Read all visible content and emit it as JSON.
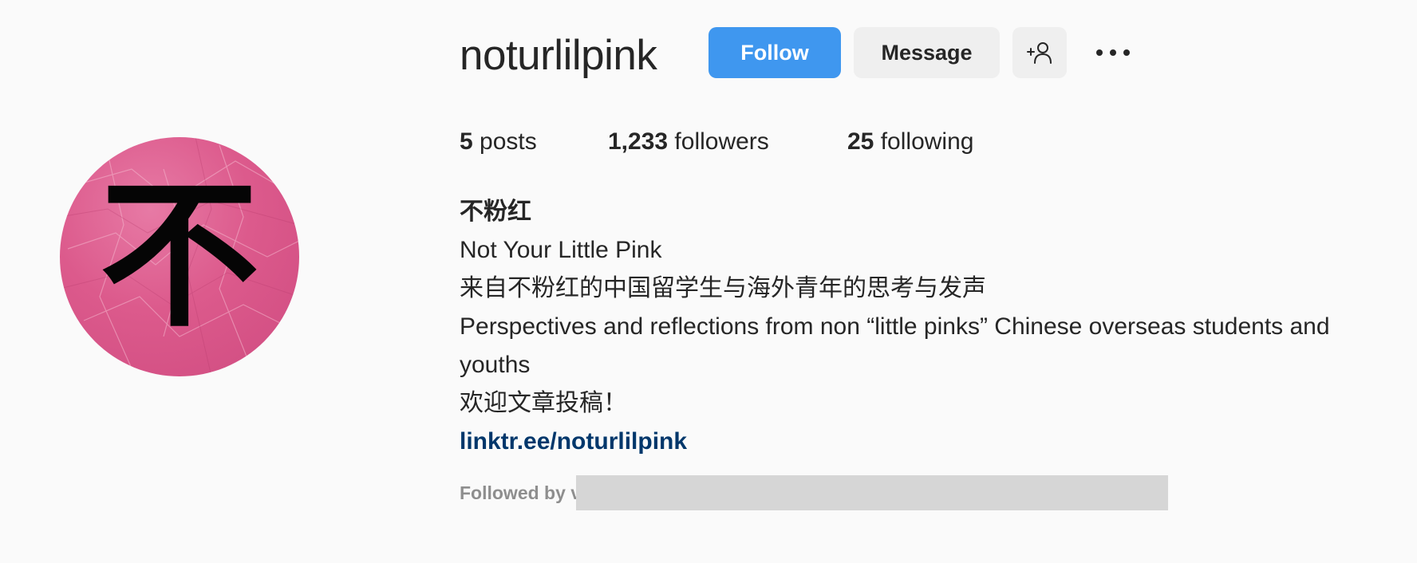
{
  "profile": {
    "username": "noturlilpink",
    "buttons": {
      "follow": "Follow",
      "message": "Message"
    },
    "stats": {
      "posts_count": "5",
      "posts_label": "posts",
      "followers_count": "1,233",
      "followers_label": "followers",
      "following_count": "25",
      "following_label": "following"
    },
    "avatar": {
      "glyph": "不",
      "color": "#d95a8b"
    },
    "bio": {
      "name": "不粉红",
      "line1": "Not Your Little Pink",
      "line2": "来自不粉红的中国留学生与海外青年的思考与发声",
      "line3": "Perspectives and reflections from non “little pinks” Chinese overseas students and",
      "line4": "youths",
      "line5": "欢迎文章投稿！",
      "link": "linktr.ee/noturlilpink"
    },
    "followed_by_label": "Followed by",
    "followed_by_visible": "v"
  },
  "colors": {
    "follow_button": "#3f97ef",
    "link": "#00376b",
    "secondary_button": "#efefef"
  },
  "icons": {
    "add_user": "add-user-icon",
    "more": "more-icon"
  }
}
